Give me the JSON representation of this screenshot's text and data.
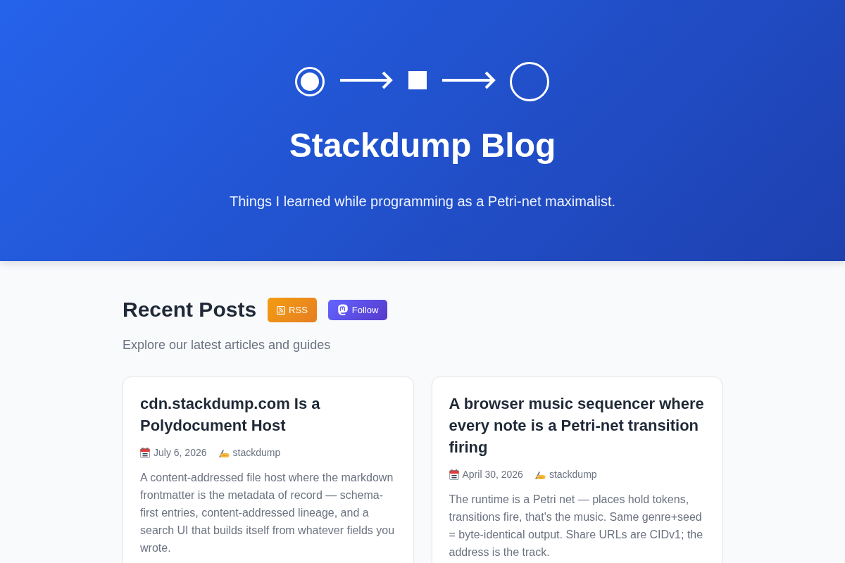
{
  "header": {
    "title": "Stackdump Blog",
    "tagline": "Things I learned while programming as a Petri-net maximalist."
  },
  "section": {
    "title": "Recent Posts",
    "buttons": [
      {
        "kind": "rss",
        "label": "RSS"
      },
      {
        "kind": "follow",
        "label": "Follow"
      }
    ],
    "subtitle": "Explore our latest articles and guides"
  },
  "posts": [
    {
      "title": "cdn.stackdump.com Is a Polydocument Host",
      "date": "July 6, 2026",
      "author": "stackdump",
      "excerpt": "A content-addressed file host where the markdown frontmatter is the metadata of record — schema-first entries, content-addressed lineage, and a search UI that builds itself from whatever fields you wrote."
    },
    {
      "title": "A browser music sequencer where every note is a Petri-net transition firing",
      "date": "April 30, 2026",
      "author": "stackdump",
      "excerpt": "The runtime is a Petri net — places hold tokens, transitions fire, that's the music. Same genre+seed = byte-identical output. Share URLs are CIDv1; the address is the track."
    }
  ]
}
